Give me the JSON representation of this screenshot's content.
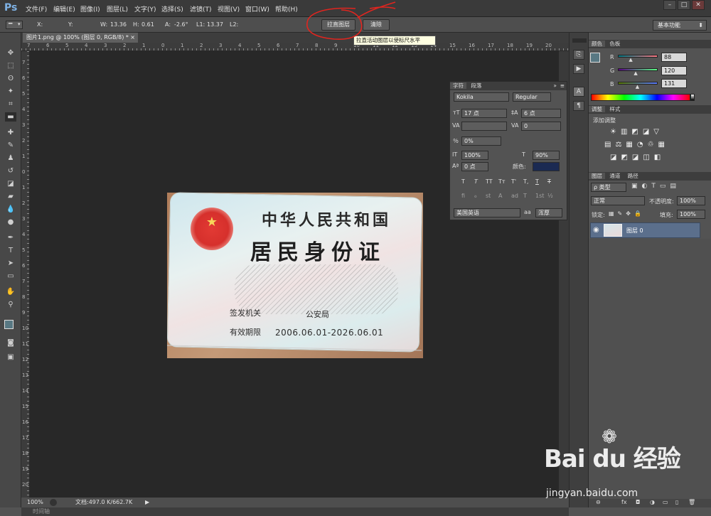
{
  "app": {
    "logo": "Ps"
  },
  "menu": [
    "文件(F)",
    "编辑(E)",
    "图像(I)",
    "图层(L)",
    "文字(Y)",
    "选择(S)",
    "滤镜(T)",
    "视图(V)",
    "窗口(W)",
    "帮助(H)"
  ],
  "window_controls": [
    "–",
    "□",
    "✕"
  ],
  "options": {
    "tool_preset": "▾",
    "x_label": "X:",
    "y_label": "Y:",
    "w_label": "W:",
    "w_value": "13.36",
    "h_label": "H:",
    "h_value": "0.61",
    "a_label": "A:",
    "a_value": "-2.6°",
    "l1_label": "L1:",
    "l1_value": "13.37",
    "l2_label": "L2:",
    "straighten_button": "拉直图层",
    "clear_button": "清除",
    "workspace": "基本功能"
  },
  "tooltip": "拉直活动图层以使标尺水平",
  "document": {
    "tab_title": "图片1.png @ 100% (图层 0, RGB/8) *",
    "tab_close": "×",
    "ruler_top_numbers": [
      "7",
      "6",
      "5",
      "4",
      "3",
      "2",
      "1",
      "0",
      "1",
      "2",
      "3",
      "4",
      "5",
      "6",
      "7",
      "8",
      "9",
      "10",
      "11",
      "12",
      "13",
      "14",
      "15",
      "16",
      "17",
      "18",
      "19",
      "20"
    ],
    "ruler_left_numbers": [
      "7",
      "6",
      "5",
      "4",
      "3",
      "2",
      "1",
      "0",
      "1",
      "2",
      "3",
      "4",
      "5",
      "6",
      "7",
      "8",
      "9",
      "10",
      "11",
      "12",
      "13",
      "14",
      "15",
      "16",
      "17",
      "18",
      "19",
      "20"
    ]
  },
  "idcard": {
    "title1": "中华人民共和国",
    "title2": "居民身份证",
    "issuer_label": "签发机关",
    "issuer_value": "公安局",
    "valid_label": "有效期限",
    "valid_value": "2006.06.01-2026.06.01"
  },
  "status": {
    "zoom": "100%",
    "doc_info": "文档:497.0 K/662.7K",
    "arrow": "▶"
  },
  "timeline_label": "时间轴",
  "character_panel": {
    "tabs": [
      "字符",
      "段落"
    ],
    "font_family": "Kokila",
    "font_style": "Regular",
    "size": "17 点",
    "leading": "6 点",
    "kerning": "",
    "tracking": "0",
    "tsume": "0%",
    "vscale": "100%",
    "hscale": "90%",
    "baseline": "0 点",
    "color_label": "颜色:",
    "color": "#1b2a52",
    "style_buttons": [
      "T",
      "T",
      "TT",
      "Tт",
      "T'",
      "T,",
      "T",
      "T"
    ],
    "ot_buttons": [
      "fi",
      "ℴ",
      "st",
      "A",
      "ad",
      "T",
      "1st",
      "½"
    ],
    "language": "美国英语",
    "aa_label": "aa",
    "antialias": "浑厚"
  },
  "color_panel": {
    "tabs": [
      "颜色",
      "色板"
    ],
    "r_label": "R",
    "r_value": "88",
    "r_fraction": 0.345,
    "g_label": "G",
    "g_value": "120",
    "g_fraction": 0.47,
    "b_label": "B",
    "b_value": "131",
    "b_fraction": 0.514,
    "fg_color": "#587883",
    "bg_color": "#ffffff"
  },
  "adjustments_panel": {
    "tabs": [
      "调整",
      "样式"
    ],
    "title": "添加调整"
  },
  "layers_panel": {
    "tabs": [
      "图层",
      "通道",
      "路径"
    ],
    "filter": "ρ 类型",
    "blend_mode": "正常",
    "opacity_label": "不透明度:",
    "opacity": "100%",
    "lock_label": "锁定:",
    "fill_label": "填充:",
    "fill": "100%",
    "layer_name": "图层 0",
    "footer_icons": [
      "⊖",
      "fx",
      "◘",
      "◑",
      "▭",
      "▯",
      "🗑"
    ]
  },
  "watermark": {
    "logo": "Bai du 经验",
    "url": "jingyan.baidu.com"
  }
}
